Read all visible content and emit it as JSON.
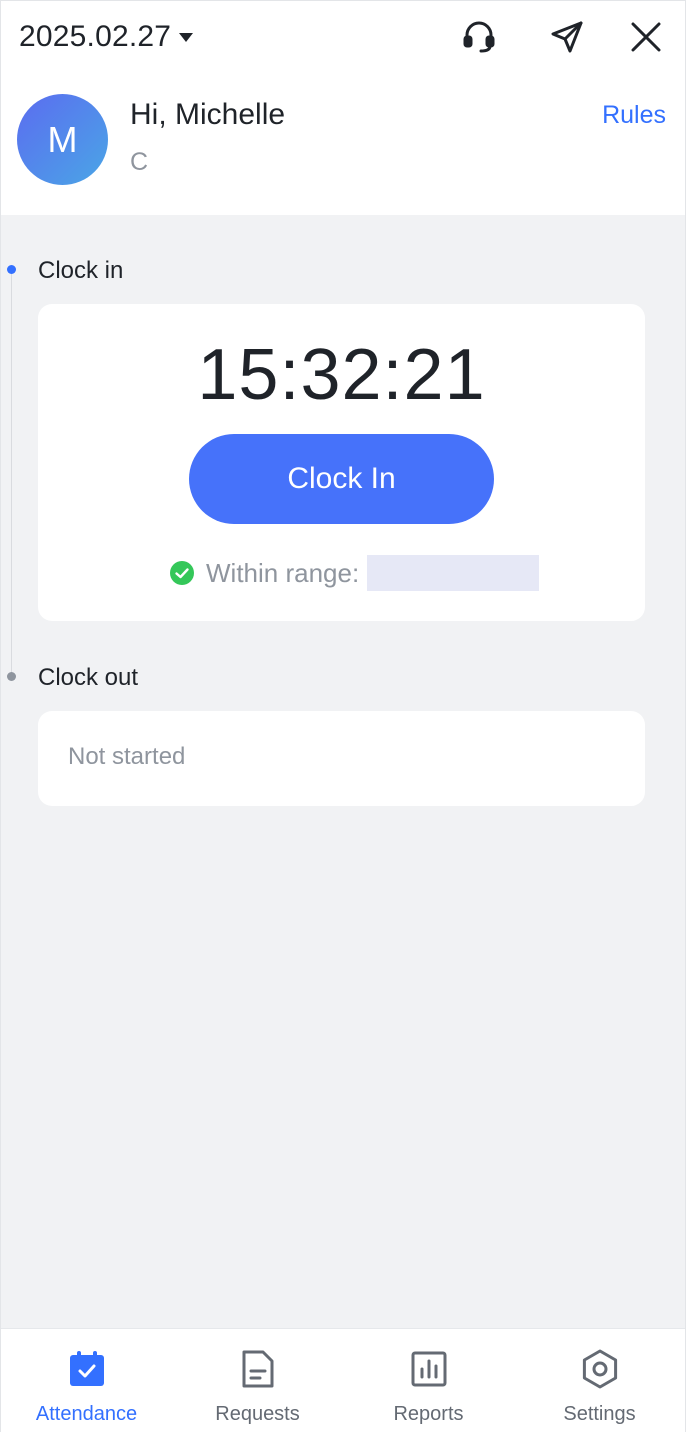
{
  "header": {
    "date": "2025.02.27",
    "greeting": "Hi, Michelle",
    "subtitle": "C",
    "avatar_initial": "M",
    "rules_label": "Rules"
  },
  "clock_in": {
    "section_label": "Clock in",
    "time": "15:32:21",
    "button_label": "Clock In",
    "range_label": "Within range:"
  },
  "clock_out": {
    "section_label": "Clock out",
    "status": "Not started"
  },
  "bottom_nav": {
    "items": [
      {
        "label": "Attendance",
        "icon": "calendar-check-icon",
        "active": true
      },
      {
        "label": "Requests",
        "icon": "document-icon",
        "active": false
      },
      {
        "label": "Reports",
        "icon": "bar-chart-icon",
        "active": false
      },
      {
        "label": "Settings",
        "icon": "gear-icon",
        "active": false
      }
    ]
  },
  "colors": {
    "accent": "#3370ff",
    "button": "#4672fa",
    "success": "#34c759",
    "background": "#f1f2f4"
  }
}
